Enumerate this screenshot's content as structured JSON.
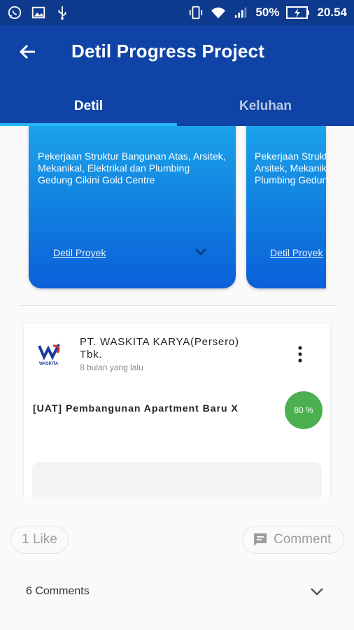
{
  "status_bar": {
    "battery": "50%",
    "time": "20.54",
    "icons_left": [
      "whatsapp-icon",
      "image-icon",
      "usb-icon"
    ],
    "icons_right": [
      "vibrate-icon",
      "wifi-icon",
      "signal-icon",
      "battery-charging-icon"
    ]
  },
  "header": {
    "title": "Detil Progress Project",
    "back_icon": "arrow-left-icon",
    "color": "#0f44a6"
  },
  "tabs": [
    {
      "label": "Detil",
      "active": true
    },
    {
      "label": "Keluhan",
      "active": false
    }
  ],
  "cards": [
    {
      "description": "Pekerjaan Struktur Bangunan Atas, Arsitek, Mekanikal, Elektrikal dan Plumbing Gedung Cikini Gold Centre",
      "link": "Detil Proyek"
    },
    {
      "description": "Pekerjaan Struktur Bangunan Atas, Arsitek, Mekanikal, Elektrikal dan Plumbing Gedung Cikini Gold Centre",
      "link": "Detil Proyek"
    }
  ],
  "post": {
    "company": "PT. WASKITA KARYA(Persero) Tbk.",
    "logo_text": "WASKITA",
    "time": "8 bulan yang lalu",
    "project_name": "[UAT] Pembangunan Apartment Baru X",
    "progress": "80 %",
    "progress_color": "#4caf50"
  },
  "actions": {
    "like_label": "1 Like",
    "comment_label": "Comment",
    "comments_count": "6 Comments"
  }
}
